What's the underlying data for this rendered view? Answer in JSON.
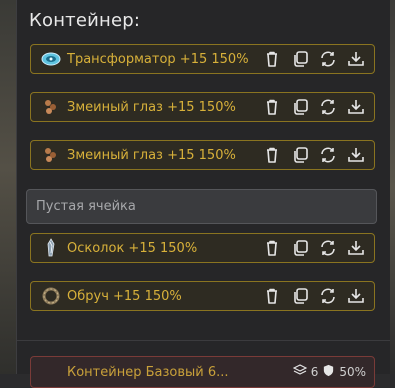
{
  "panel": {
    "title": "Контейнер:"
  },
  "slots": [
    {
      "label": "Трансформатор +15 150%",
      "icon": "transformer-icon"
    },
    {
      "label": "Змеиный глаз +15 150%",
      "icon": "snake-eye-icon"
    },
    {
      "label": "Змеиный глаз +15 150%",
      "icon": "snake-eye-icon"
    },
    {
      "label": "Осколок +15 150%",
      "icon": "shard-icon"
    },
    {
      "label": "Обруч +15 150%",
      "icon": "hoop-icon"
    }
  ],
  "empty_slot": {
    "label": "Пустая ячейка"
  },
  "actions": [
    "trash-icon",
    "copy-icon",
    "sync-icon",
    "download-icon"
  ],
  "next_card": {
    "label": "Контейнер Базовый 6...",
    "count": "6",
    "percent": "50%"
  },
  "colors": {
    "accent_gold": "#d8b13a",
    "slot_border": "#8a7420",
    "danger_border": "#7a3b38"
  }
}
